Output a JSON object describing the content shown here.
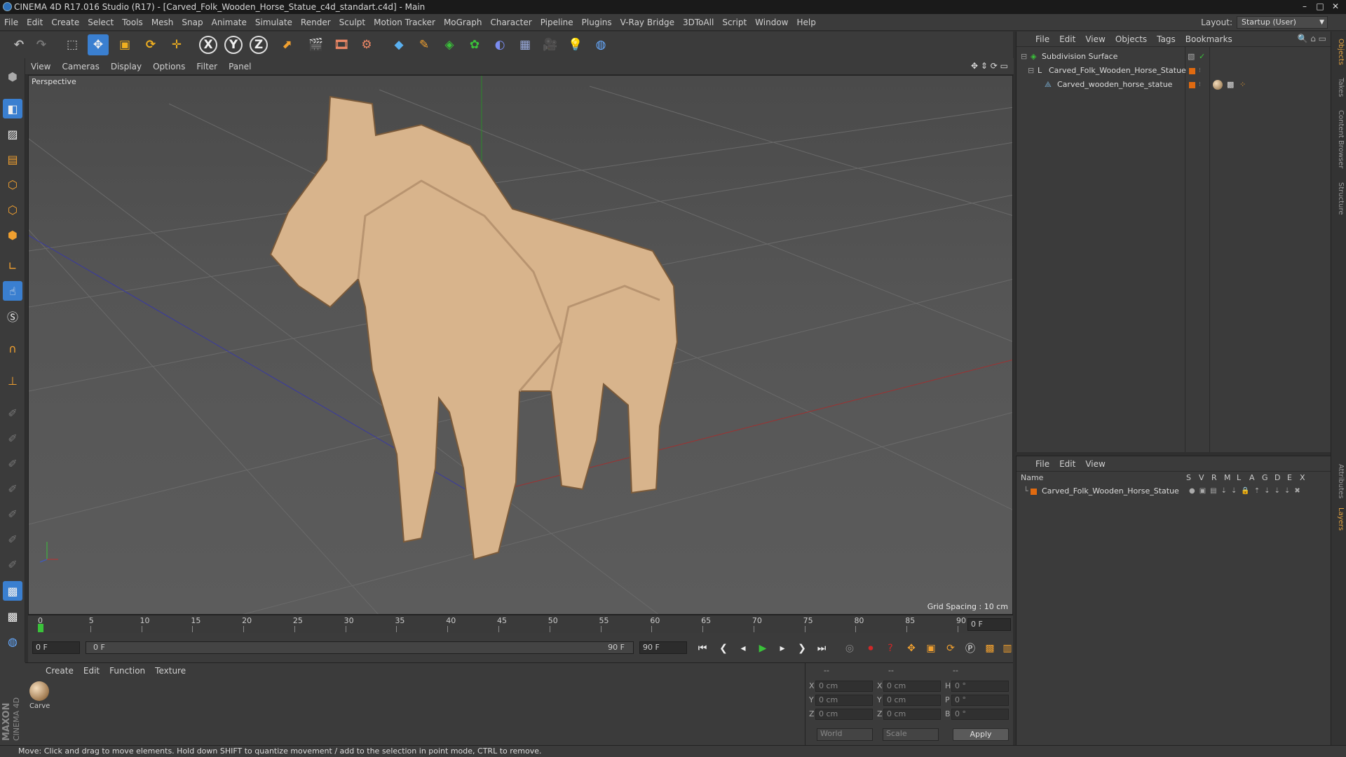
{
  "window": {
    "title": "CINEMA 4D R17.016 Studio (R17) - [Carved_Folk_Wooden_Horse_Statue_c4d_standart.c4d] - Main",
    "controls": [
      "–",
      "□",
      "✕"
    ]
  },
  "menubar": {
    "items": [
      "File",
      "Edit",
      "Create",
      "Select",
      "Tools",
      "Mesh",
      "Snap",
      "Animate",
      "Simulate",
      "Render",
      "Sculpt",
      "Motion Tracker",
      "MoGraph",
      "Character",
      "Pipeline",
      "Plugins",
      "V-Ray Bridge",
      "3DToAll",
      "Script",
      "Window",
      "Help"
    ],
    "layout_label": "Layout:",
    "layout_value": "Startup (User)"
  },
  "toolbar": {
    "axis_x": "X",
    "axis_y": "Y",
    "axis_z": "Z"
  },
  "viewport": {
    "menu": [
      "View",
      "Cameras",
      "Display",
      "Options",
      "Filter",
      "Panel"
    ],
    "camera_label": "Perspective",
    "grid_spacing": "Grid Spacing : 10 cm"
  },
  "timeline": {
    "ticks": [
      "0",
      "5",
      "10",
      "15",
      "20",
      "25",
      "30",
      "35",
      "40",
      "45",
      "50",
      "55",
      "60",
      "65",
      "70",
      "75",
      "80",
      "85",
      "90"
    ],
    "current_frame": "0 F",
    "start_field": "0 F",
    "range_start": "0 F",
    "range_end": "90 F",
    "end_field": "90 F"
  },
  "materials": {
    "menu": [
      "Create",
      "Edit",
      "Function",
      "Texture"
    ],
    "items": [
      {
        "name": "Carve"
      }
    ]
  },
  "attributes": {
    "headers": [
      "--",
      "--",
      "--"
    ],
    "rows": [
      {
        "l1": "X",
        "v1": "0 cm",
        "l2": "X",
        "v2": "0 cm",
        "l3": "H",
        "v3": "0 °"
      },
      {
        "l1": "Y",
        "v1": "0 cm",
        "l2": "Y",
        "v2": "0 cm",
        "l3": "P",
        "v3": "0 °"
      },
      {
        "l1": "Z",
        "v1": "0 cm",
        "l2": "Z",
        "v2": "0 cm",
        "l3": "B",
        "v3": "0 °"
      }
    ],
    "coord_system": "World",
    "mode": "Scale",
    "apply_label": "Apply"
  },
  "objects_panel": {
    "menu": [
      "File",
      "Edit",
      "View",
      "Objects",
      "Tags",
      "Bookmarks"
    ],
    "tree": [
      {
        "name": "Subdivision Surface",
        "indent": 0
      },
      {
        "name": "Carved_Folk_Wooden_Horse_Statue",
        "indent": 1
      },
      {
        "name": "Carved_wooden_horse_statue",
        "indent": 2
      }
    ]
  },
  "layers_panel": {
    "menu": [
      "File",
      "Edit",
      "View"
    ],
    "columns": [
      "Name",
      "S",
      "V",
      "R",
      "M",
      "L",
      "A",
      "G",
      "D",
      "E",
      "X"
    ],
    "rows": [
      {
        "name": "Carved_Folk_Wooden_Horse_Statue",
        "color": "#e06a10"
      }
    ]
  },
  "right_tabs": [
    "Objects",
    "Takes",
    "Content Browser",
    "Structure",
    "Attributes",
    "Layers"
  ],
  "branding": {
    "line1": "MAXON",
    "line2": "CINEMA 4D"
  },
  "status": {
    "message": "Move: Click and drag to move elements. Hold down SHIFT to quantize movement / add to the selection in point mode, CTRL to remove."
  },
  "colors": {
    "accent_blue": "#3a7fd0",
    "layer_orange": "#e06a10",
    "play_green": "#3ac23a",
    "record_red": "#d02828",
    "horse_wood": "#d8b48c"
  }
}
